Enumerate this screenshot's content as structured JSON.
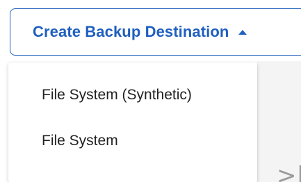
{
  "dropdown": {
    "label": "Create Backup Destination",
    "caret_icon": "caret-up-icon",
    "accent_color": "#1f5fbf"
  },
  "menu": {
    "items": [
      {
        "label": "File System (Synthetic)"
      },
      {
        "label": "File System"
      }
    ]
  },
  "background": {
    "pager_glyph": ">|",
    "pager_icon": "last-page-icon"
  }
}
